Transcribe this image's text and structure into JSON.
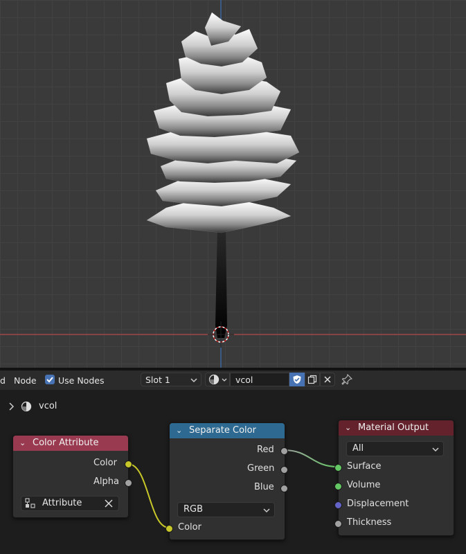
{
  "header": {
    "partial_menu": "d",
    "node_menu": "Node",
    "use_nodes_label": "Use Nodes",
    "slot_label": "Slot 1",
    "material_name": "vcol"
  },
  "breadcrumb": {
    "material": "vcol"
  },
  "nodes": {
    "color_attribute": {
      "title": "Color Attribute",
      "outputs": [
        "Color",
        "Alpha"
      ],
      "attribute_field": "Attribute"
    },
    "separate_color": {
      "title": "Separate Color",
      "outputs": [
        "Red",
        "Green",
        "Blue"
      ],
      "mode": "RGB",
      "input": "Color"
    },
    "material_output": {
      "title": "Material Output",
      "target": "All",
      "inputs": [
        "Surface",
        "Volume",
        "Displacement",
        "Thickness"
      ]
    }
  },
  "colors": {
    "color_attr_header": "#9a3a50",
    "separate_header": "#2d6990",
    "output_header": "#63222c",
    "socket_yellow": "#c7c729",
    "socket_gray": "#a1a1a1",
    "socket_green": "#63c763",
    "socket_purple": "#6363c7",
    "accent": "#4772b3"
  },
  "icons": [
    "chevron-right-icon",
    "material-sphere-icon",
    "checkbox-icon",
    "chevron-down-icon",
    "shield-icon",
    "duplicate-icon",
    "close-icon",
    "pin-icon",
    "attribute-icon"
  ]
}
